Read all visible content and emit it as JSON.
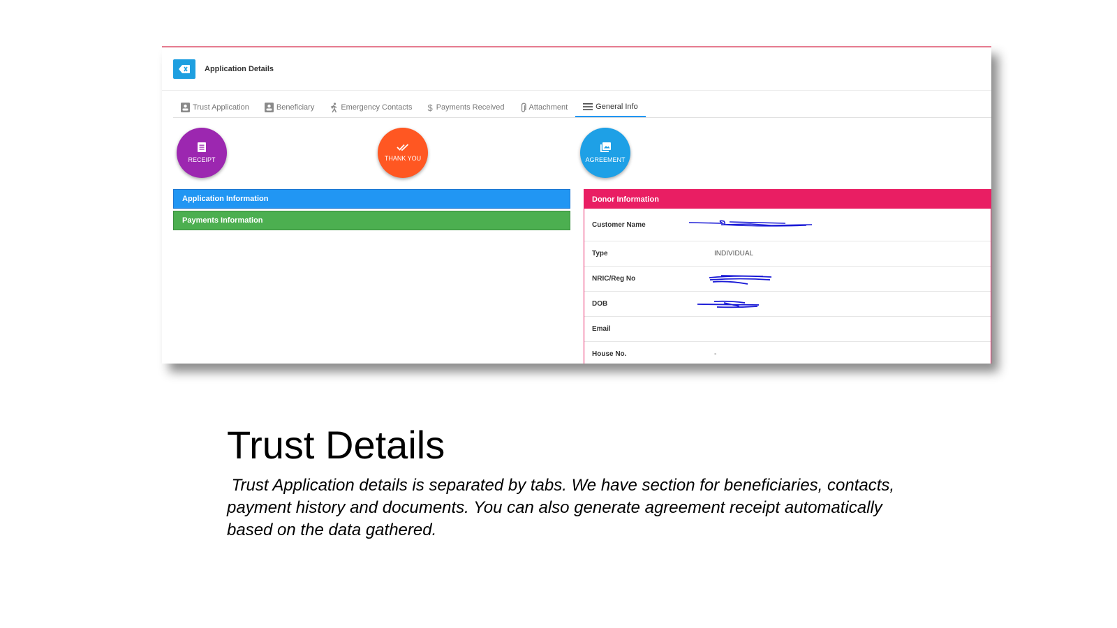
{
  "app": {
    "title": "Application Details"
  },
  "icons": {
    "back": "backspace-icon",
    "receipt": "document-icon",
    "thank_you": "double-check-icon",
    "agreement": "gallery-icon"
  },
  "tabs": [
    {
      "label": "Trust Application",
      "icon": "id-card-icon",
      "active": false
    },
    {
      "label": "Beneficiary",
      "icon": "id-card-icon",
      "active": false
    },
    {
      "label": "Emergency Contacts",
      "icon": "running-person-icon",
      "active": false
    },
    {
      "label": "Payments Received",
      "icon": "dollar-icon",
      "active": false
    },
    {
      "label": "Attachment",
      "icon": "paperclip-icon",
      "active": false
    },
    {
      "label": "General Info",
      "icon": "menu-icon",
      "active": true
    }
  ],
  "actions": {
    "receipt": "RECEIPT",
    "thank_you": "THANK YOU",
    "agreement": "AGREEMENT"
  },
  "panels": {
    "application_information": "Application Information",
    "payments_information": "Payments Information"
  },
  "donor": {
    "heading": "Donor Information",
    "rows": [
      {
        "label": "Customer Name",
        "value": ""
      },
      {
        "label": "Type",
        "value": "INDIVIDUAL"
      },
      {
        "label": "NRIC/Reg No",
        "value": ""
      },
      {
        "label": "DOB",
        "value": ""
      },
      {
        "label": "Email",
        "value": ""
      },
      {
        "label": "House No.",
        "value": "-"
      }
    ]
  },
  "slide": {
    "title": "Trust Details",
    "description": " Trust Application details is separated by tabs. We have section for beneficiaries, contacts, payment history and documents. You can also generate agreement receipt automatically based on the data gathered."
  },
  "colors": {
    "receipt": "#9c27b0",
    "thank_you": "#ff5722",
    "agreement": "#1ea0e6",
    "application_bar": "#2196f3",
    "payments_bar": "#4caf50",
    "donor_bar": "#e91e63",
    "redaction": "#1a1ad6"
  }
}
